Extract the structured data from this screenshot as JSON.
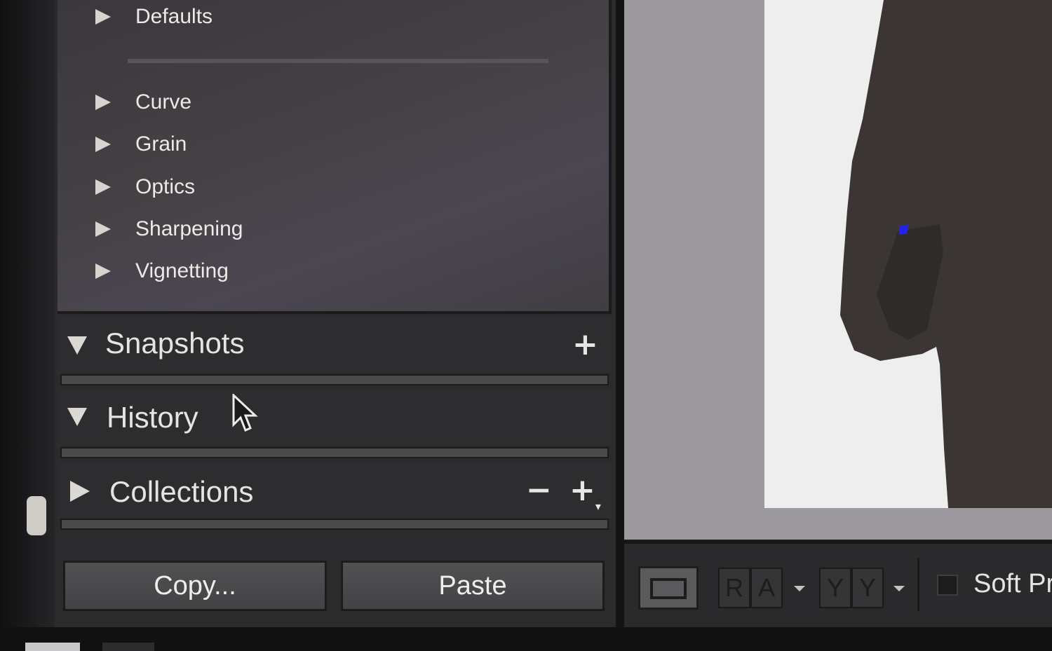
{
  "presets": {
    "items": [
      {
        "label": "Defaults"
      },
      {
        "label": "Curve"
      },
      {
        "label": "Grain"
      },
      {
        "label": "Optics"
      },
      {
        "label": "Sharpening"
      },
      {
        "label": "Vignetting"
      }
    ]
  },
  "sections": {
    "snapshots": {
      "label": "Snapshots",
      "add_icon": "plus-icon"
    },
    "history": {
      "label": "History"
    },
    "collections": {
      "label": "Collections",
      "remove_icon": "minus-icon",
      "add_icon": "plus-dropdown-icon"
    }
  },
  "buttons": {
    "copy": "Copy...",
    "paste": "Paste"
  },
  "toolbar": {
    "before_after_left": "R",
    "before_after_right": "A",
    "compare_left": "Y",
    "compare_right": "Y",
    "soft_proofing_label": "Soft Pr"
  },
  "colors": {
    "panel": "#2b2a2c",
    "photo_background": "#eeeeef",
    "text": "#ece9e6"
  }
}
